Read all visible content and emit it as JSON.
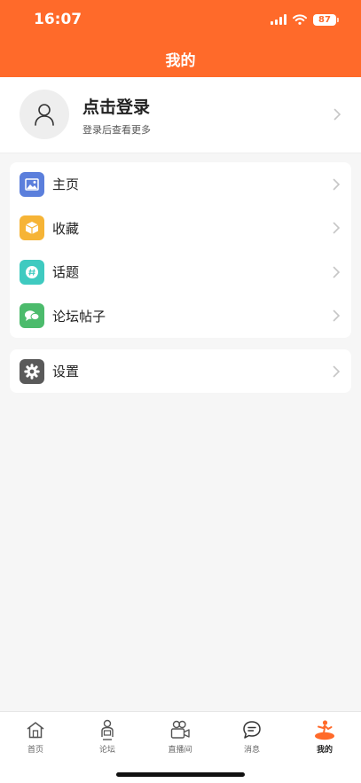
{
  "status_bar": {
    "time": "16:07",
    "battery": "87",
    "icons": [
      "cellular-signal-icon",
      "wifi-icon",
      "battery-icon"
    ]
  },
  "header": {
    "title": "我的",
    "background_color": "#ff6a2a"
  },
  "profile": {
    "avatar_icon": "user-icon",
    "title": "点击登录",
    "subtitle": "登录后查看更多"
  },
  "menu": {
    "items": [
      {
        "label": "主页",
        "icon": "picture-icon",
        "color": "#5b7fdc"
      },
      {
        "label": "收藏",
        "icon": "box-icon",
        "color": "#f6b436"
      },
      {
        "label": "话题",
        "icon": "hashtag-icon",
        "color": "#3fcac0"
      },
      {
        "label": "论坛帖子",
        "icon": "chat-bubbles-icon",
        "color": "#4cbb6c"
      }
    ]
  },
  "settings": {
    "label": "设置",
    "icon": "gear-icon",
    "color": "#5a5a5a"
  },
  "tabbar": {
    "tabs": [
      {
        "label": "首页",
        "icon": "home-icon",
        "active": false
      },
      {
        "label": "论坛",
        "icon": "forum-icon",
        "active": false
      },
      {
        "label": "直播间",
        "icon": "video-camera-icon",
        "active": false
      },
      {
        "label": "消息",
        "icon": "message-icon",
        "active": false
      },
      {
        "label": "我的",
        "icon": "my-profile-icon",
        "active": true
      }
    ],
    "active_color": "#ff6a2a"
  }
}
